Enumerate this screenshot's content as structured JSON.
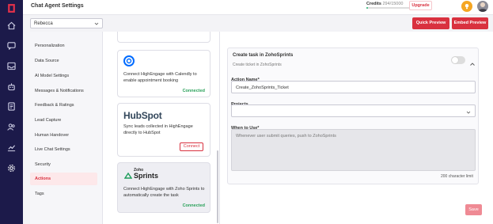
{
  "header": {
    "title": "Chat Agent Settings",
    "credits_label": "Credits",
    "credits_value": "294/15000",
    "credits_percent": "2%",
    "credits_progress": 0.02,
    "upgrade_label": "Upgrade"
  },
  "agent_select": {
    "value": "Rebecca"
  },
  "actions": {
    "quick_preview": "Quick Preview",
    "embed_preview": "Embed Preview"
  },
  "sidebar": {
    "items": [
      {
        "label": "Personalization"
      },
      {
        "label": "Data Source"
      },
      {
        "label": "AI Model Settings"
      },
      {
        "label": "Messages & Notifications"
      },
      {
        "label": "Feedback & Ratings"
      },
      {
        "label": "Lead Capture"
      },
      {
        "label": "Human Handover"
      },
      {
        "label": "Live Chat Settings"
      },
      {
        "label": "Security"
      },
      {
        "label": "Actions"
      },
      {
        "label": "Tags"
      }
    ],
    "active": "Actions"
  },
  "integrations": [
    {
      "name": "Calendly",
      "description": "Connect HighEngage with Calendly to enable appointment booking",
      "status": "Connected"
    },
    {
      "name": "HubSpot",
      "logo_text": "HubSpot",
      "description": "Sync leads collected in HighEngage directly to HubSpot",
      "button": "Connect"
    },
    {
      "name": "Zoho Sprints",
      "logo_top": "Zoho",
      "logo_bottom": "Sprints",
      "description": "Connect HighEngage with Zoho Sprints to automatically create the task",
      "status": "Connected"
    }
  ],
  "task_panel": {
    "title": "Create task in ZohoSprints",
    "subtitle": "Create ticket in ZohoSprints",
    "action_name_label": "Action Name*",
    "action_name_value": "Create_ZohoSprints_Ticket",
    "projects_label": "Projects",
    "projects_value": "",
    "when_to_use_label": "When to Use*",
    "when_to_use_placeholder": "Whenever user submit queries, push to ZohoSprints",
    "char_limit": "200 character limit",
    "save_label": "Save"
  },
  "colors": {
    "brand_red": "#d9313f",
    "nav_bg": "#1c1a4a",
    "connected_green": "#2aa15a"
  },
  "icons": [
    "app-logo-icon",
    "home-icon",
    "chat-icon",
    "inbox-icon",
    "bot-icon",
    "document-icon",
    "users-icon",
    "analytics-icon",
    "settings-icon",
    "bulb-icon",
    "chevron-down-icon",
    "chevron-up-icon"
  ]
}
